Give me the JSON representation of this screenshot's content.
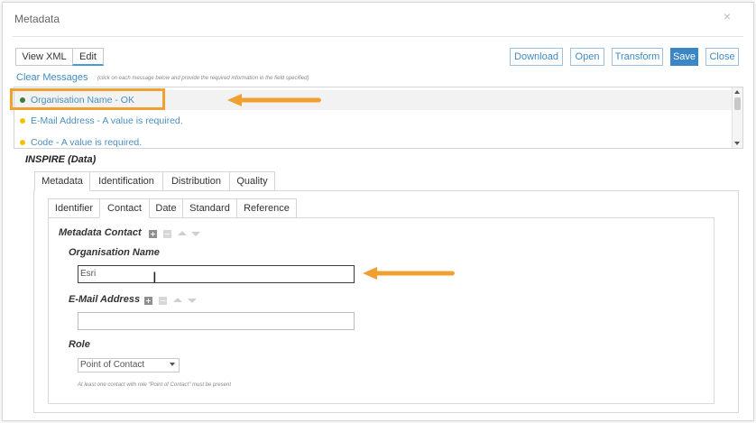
{
  "window": {
    "title": "Metadata"
  },
  "toolbar": {
    "view_xml": "View XML",
    "edit": "Edit",
    "download": "Download",
    "open": "Open",
    "transform": "Transform",
    "save": "Save",
    "close": "Close"
  },
  "messages": {
    "clear": "Clear Messages",
    "hint": "(click on each message below and provide the required information in the field specified)",
    "items": [
      {
        "text": "Organisation Name - OK",
        "status_color": "#3f7a3f"
      },
      {
        "text": "E-Mail Address - A value is required.",
        "status_color": "#f2c200"
      },
      {
        "text": "Code - A value is required.",
        "status_color": "#f2c200"
      }
    ]
  },
  "section": {
    "title": "INSPIRE (Data)"
  },
  "tabs": [
    "Metadata",
    "Identification",
    "Distribution",
    "Quality"
  ],
  "subtabs": [
    "Identifier",
    "Contact",
    "Date",
    "Standard",
    "Reference"
  ],
  "form": {
    "group_label": "Metadata Contact",
    "org_label": "Organisation Name",
    "org_value": "Esri",
    "email_label": "E-Mail Address",
    "email_value": "",
    "role_label": "Role",
    "role_value": "Point of Contact",
    "role_note": "At least one contact with role \"Point of Contact\" must be present"
  },
  "colors": {
    "accent": "#3f8ac2",
    "highlight": "#f0a030",
    "primary_button": "#3b86c4"
  },
  "icons": [
    "close-icon",
    "arrow-icon",
    "plus-icon",
    "minus-icon",
    "move-up-icon",
    "move-down-icon",
    "text-cursor-icon"
  ]
}
